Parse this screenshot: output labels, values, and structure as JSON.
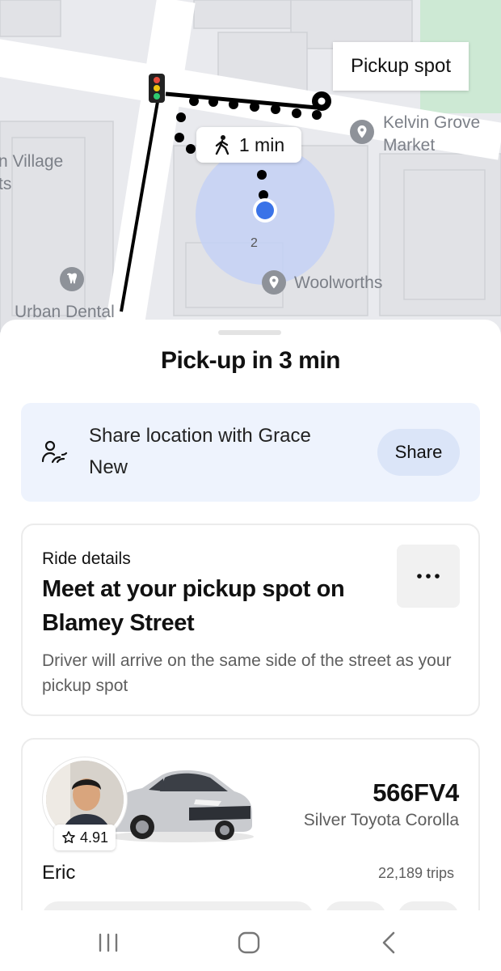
{
  "map": {
    "pickup_callout": "Pickup spot",
    "walk_time": "1 min",
    "floor_number": "2",
    "places": {
      "kelvin_grove_line1": "Kelvin Grove",
      "kelvin_grove_line2": "Market",
      "village_line1": "n Village",
      "village_line2": "ts",
      "woolworths": "Woolworths",
      "urban_dental": "Urban Dental"
    },
    "colors": {
      "user_dot": "#3a73e8",
      "accuracy_circle": "#c3d1f6",
      "park": "#cde9d4"
    }
  },
  "sheet": {
    "title": "Pick-up in 3 min",
    "share": {
      "icon": "share-location-icon",
      "text": "Share location with Grace New",
      "button": "Share"
    },
    "ride_details": {
      "eyebrow": "Ride details",
      "headline": "Meet at your pickup spot on Blamey Street",
      "description": "Driver will arrive on the same side of the street as your pickup spot",
      "more_icon": "more-horizontal-icon"
    },
    "driver": {
      "rating": "4.91",
      "plate": "566FV4",
      "car": "Silver Toyota Corolla",
      "name": "Eric",
      "trips": "22,189 trips"
    }
  },
  "navbar": {
    "recents_icon": "recent-apps-icon",
    "home_icon": "home-icon",
    "back_icon": "back-icon"
  }
}
